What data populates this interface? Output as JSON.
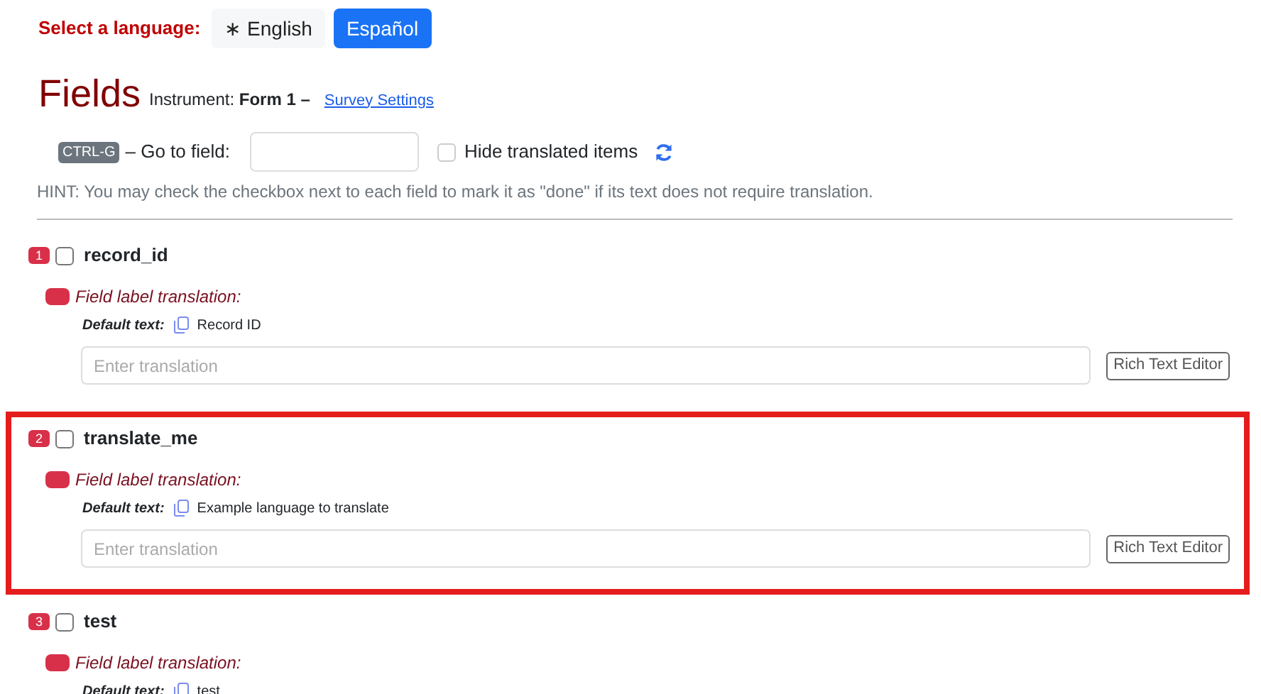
{
  "language_selector": {
    "label": "Select a language:",
    "options": [
      {
        "label": "∗ English",
        "selected": false
      },
      {
        "label": "Español",
        "selected": true
      }
    ]
  },
  "header": {
    "title": "Fields",
    "instrument_label": "Instrument:",
    "instrument_name": "Form 1 –",
    "link": "Survey Settings"
  },
  "goto": {
    "shortcut": "CTRL-G",
    "label": "– Go to field:",
    "hide_translated": {
      "label": "Hide translated items",
      "checked": false
    }
  },
  "hint": "HINT: You may check the checkbox next to each field to mark it as \"done\" if its text does not require translation.",
  "fields": [
    {
      "number": "1",
      "name": "record_id",
      "checked": false,
      "highlighted": false,
      "translation_label": "Field label translation:",
      "default_label": "Default text:",
      "default_text": "Record ID",
      "placeholder": "Enter translation",
      "button": "Rich Text Editor"
    },
    {
      "number": "2",
      "name": "translate_me",
      "checked": false,
      "highlighted": true,
      "translation_label": "Field label translation:",
      "default_label": "Default text:",
      "default_text": "Example language to translate",
      "placeholder": "Enter translation",
      "button": "Rich Text Editor"
    },
    {
      "number": "3",
      "name": "test",
      "checked": false,
      "highlighted": false,
      "translation_label": "Field label translation:",
      "default_label": "Default text:",
      "default_text": "test"
    }
  ]
}
